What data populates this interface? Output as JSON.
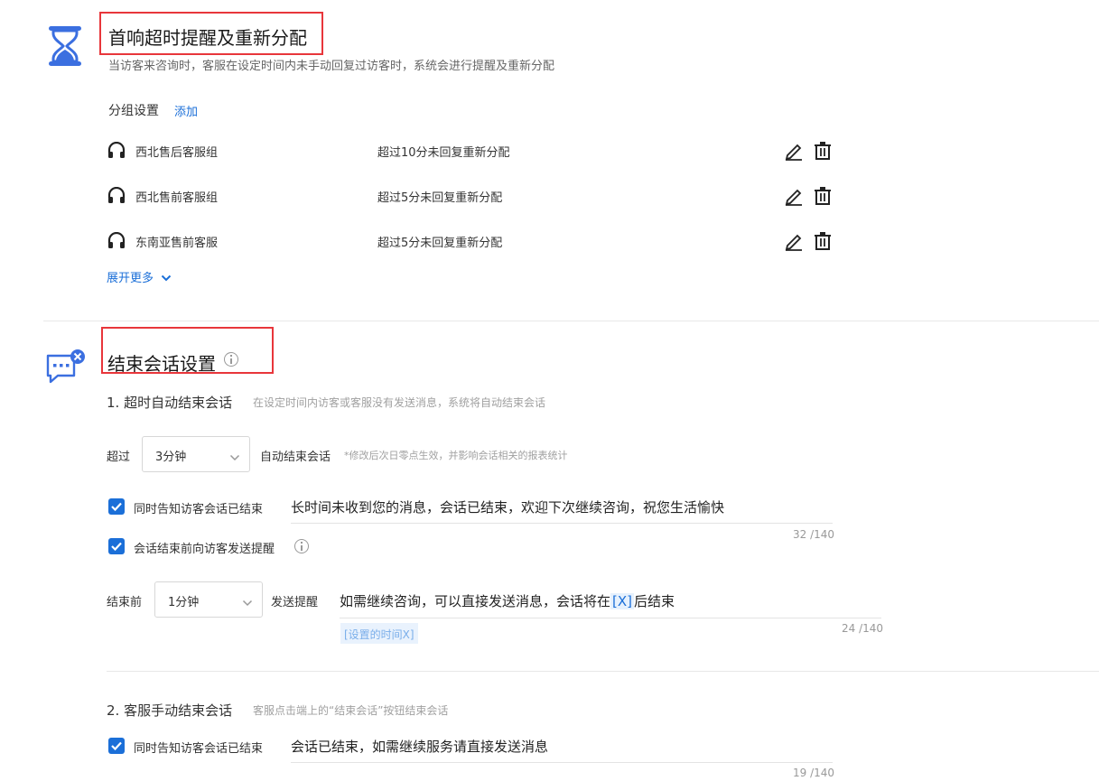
{
  "section1": {
    "title": "首响超时提醒及重新分配",
    "description": "当访客来咨询时，客服在设定时间内未手动回复过访客时，系统会进行提醒及重新分配",
    "group_settings_label": "分组设置",
    "add_link": "添加",
    "groups": [
      {
        "name": "西北售后客服组",
        "rule": "超过10分未回复重新分配"
      },
      {
        "name": "西北售前客服组",
        "rule": "超过5分未回复重新分配"
      },
      {
        "name": "东南亚售前客服",
        "rule": "超过5分未回复重新分配"
      }
    ],
    "expand_more": "展开更多"
  },
  "section2": {
    "title": "结束会话设置",
    "auto_end": {
      "heading": "1. 超时自动结束会话",
      "hint": "在设定时间内访客或客服没有发送消息，系统将自动结束会话",
      "prefix": "超过",
      "select_value": "3分钟",
      "suffix": "自动结束会话",
      "note": "*修改后次日零点生效，并影响会话相关的报表统计",
      "notify_label": "同时告知访客会话已结束",
      "notify_message": "长时间未收到您的消息，会话已结束，欢迎下次继续咨询，祝您生活愉快",
      "notify_count": "32 /140",
      "remind_label": "会话结束前向访客发送提醒",
      "before_label": "结束前",
      "before_select": "1分钟",
      "send_label": "发送提醒",
      "remind_message_pre": "如需继续咨询，可以直接发送消息，会话将在",
      "remind_message_var": "[X]",
      "remind_message_post": "后结束",
      "var_chip": "[设置的时间X]",
      "remind_count": "24 /140"
    },
    "manual_end": {
      "heading": "2. 客服手动结束会话",
      "hint": "客服点击端上的“结束会话”按钮结束会话",
      "notify_label": "同时告知访客会话已结束",
      "notify_message": "会话已结束，如需继续服务请直接发送消息",
      "notify_count": "19 /140"
    }
  },
  "colors": {
    "accent": "#1b6fd8",
    "highlight_box": "#e8363b",
    "icon_blue": "#3b6fe0"
  }
}
